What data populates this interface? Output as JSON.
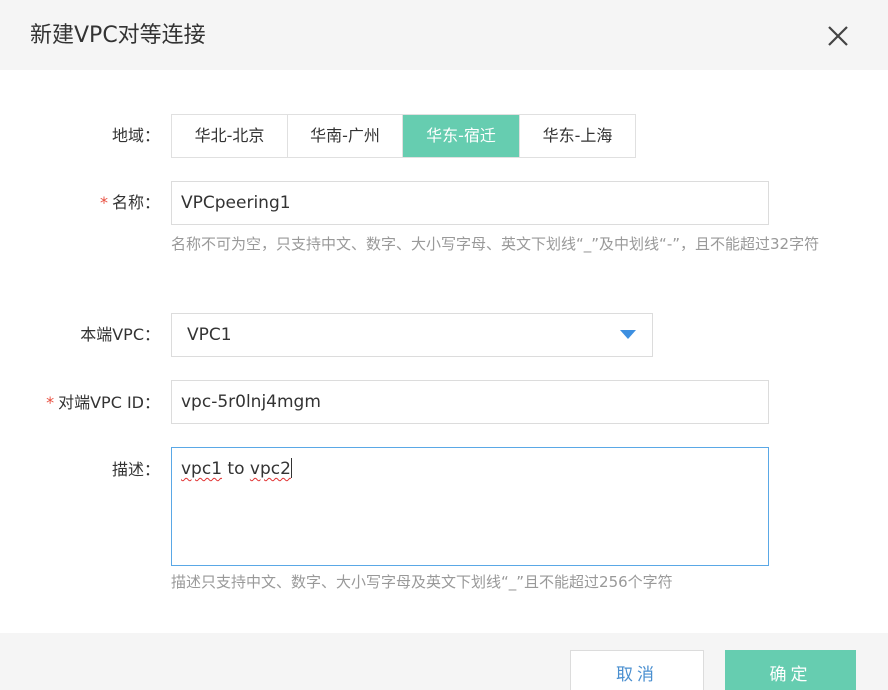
{
  "dialog": {
    "title": "新建VPC对等连接",
    "close_icon": "close-icon"
  },
  "region": {
    "label": "地域：",
    "options": [
      "华北-北京",
      "华南-广州",
      "华东-宿迁",
      "华东-上海"
    ],
    "selected": "华东-宿迁",
    "active_color": "#66cdb0"
  },
  "name": {
    "required_mark": "*",
    "label": "名称：",
    "value": "VPCpeering1",
    "hint": "名称不可为空，只支持中文、数字、大小写字母、英文下划线“_”及中划线“-”，且不能超过32字符"
  },
  "local_vpc": {
    "label": "本端VPC：",
    "value": "VPC1",
    "arrow_icon": "dropdown-arrow-icon"
  },
  "peer_vpc": {
    "required_mark": "*",
    "label": "对端VPC ID：",
    "value": "vpc-5r0lnj4mgm"
  },
  "description": {
    "label": "描述：",
    "value_parts": [
      "vpc1",
      " to ",
      "vpc2"
    ],
    "hint": "描述只支持中文、数字、大小写字母及英文下划线“_”且不能超过256个字符"
  },
  "footer": {
    "cancel_label": "取消",
    "ok_label": "确定"
  }
}
